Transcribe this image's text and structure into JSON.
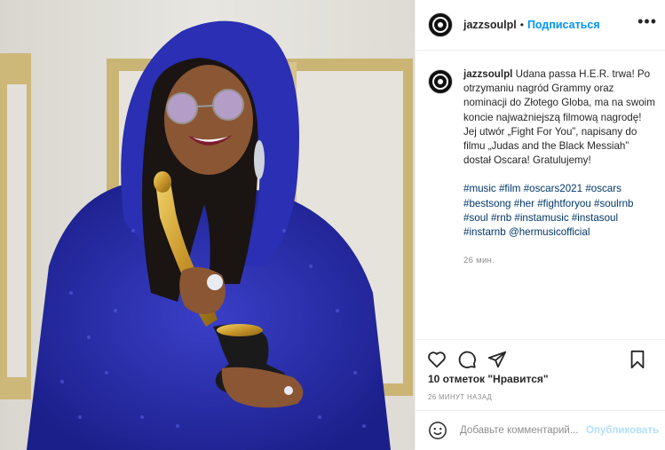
{
  "header": {
    "username": "jazzsoulpl",
    "separator": "•",
    "follow_label": "Подписаться",
    "more_label": "•••"
  },
  "caption": {
    "username": "jazzsoulpl",
    "text": "Udana passa H.E.R. trwa! Po otrzymaniu nagród Grammy oraz nominacji do Złotego Globa, ma na swoim koncie najważniejszą filmową nagrodę! Jej utwór „Fight For You”, napisany do filmu „Judas and the Black Messiah” dostał Oscara! Gratulujemy!",
    "hashtags": [
      "#music",
      "#film",
      "#oscars2021",
      "#oscars",
      "#bestsong",
      "#her",
      "#fightforyou",
      "#soulrnb",
      "#soul",
      "#rnb",
      "#instamusic",
      "#instasoul",
      "#instarnb",
      "@hermusicofficial"
    ],
    "time": "26 мин."
  },
  "actions": {
    "like_icon": "heart-icon",
    "comment_icon": "comment-icon",
    "share_icon": "share-icon",
    "save_icon": "bookmark-icon"
  },
  "likes": "10 отметок \"Нравится\"",
  "time_ago": "26 МИНУТ НАЗАД",
  "comment": {
    "placeholder": "Добавьте комментарий...",
    "publish_label": "Опубликовать",
    "emoji_icon": "smiley-icon"
  },
  "colors": {
    "accent": "#0095f6",
    "hashtag": "#00376b",
    "muted": "#8e8e8e",
    "border": "#efefef"
  }
}
